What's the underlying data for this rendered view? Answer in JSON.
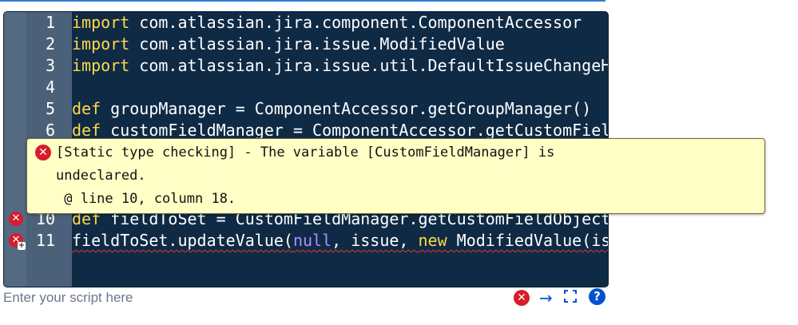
{
  "editor": {
    "lines": [
      {
        "number": "1",
        "keyword": "import",
        "rest": " com.atlassian.jira.component.ComponentAccessor"
      },
      {
        "number": "2",
        "keyword": "import",
        "rest": " com.atlassian.jira.issue.ModifiedValue"
      },
      {
        "number": "3",
        "keyword": "import",
        "rest": " com.atlassian.jira.issue.util.DefaultIssueChangeH"
      },
      {
        "number": "4",
        "keyword": "",
        "rest": ""
      },
      {
        "number": "5",
        "keyword": "def",
        "rest": " groupManager = ComponentAccessor.getGroupManager()"
      },
      {
        "number": "6",
        "keyword": "def",
        "rest": " customFieldManager = ComponentAccessor.getCustomFiel"
      },
      {
        "number": "10",
        "keyword": "def",
        "rest": " fieldToSet = CustomFieldManager.getCustomFieldObject"
      },
      {
        "number": "11",
        "seg1": "fieldToSet.updateValue(",
        "null_kw": "null",
        "seg2": ", issue, ",
        "new_kw": "new",
        "seg3": " ModifiedValue(is"
      }
    ]
  },
  "tooltip": {
    "line1": "[Static type checking] - The variable [CustomFieldManager] is",
    "line2": "undeclared.",
    "line3": " @ line 10, column 18."
  },
  "footer": {
    "placeholder": "Enter your script here"
  },
  "icons": {
    "error": "error-icon",
    "arrow": "arrow-right-icon",
    "expand": "fullscreen-icon",
    "help": "help-icon"
  },
  "colors": {
    "editor_bg": "#0f2a45",
    "keyword": "#ffd94a",
    "literal": "#b18cff",
    "tooltip_bg": "#ffffc6",
    "error": "#d71c2b",
    "link": "#0052cc"
  }
}
